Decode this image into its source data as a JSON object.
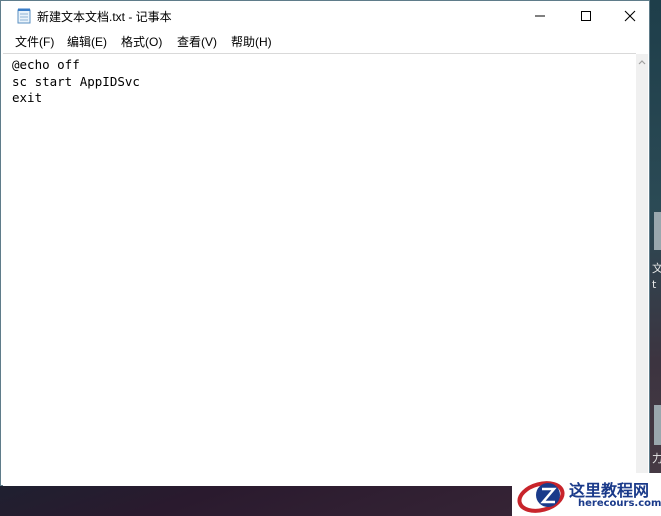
{
  "window": {
    "title": "新建文本文档.txt - 记事本"
  },
  "menu": {
    "items": [
      {
        "label": "文件(F)"
      },
      {
        "label": "编辑(E)"
      },
      {
        "label": "格式(O)"
      },
      {
        "label": "查看(V)"
      },
      {
        "label": "帮助(H)"
      }
    ]
  },
  "editor": {
    "content": "@echo off\nsc start AppIDSvc\nexit"
  },
  "desktop": {
    "snippet_1": "文",
    "snippet_2": "t",
    "snippet_3": "力"
  },
  "watermark": {
    "title": "这里教程网",
    "url": "herecours.com"
  },
  "colors": {
    "window_border": "#5f7c8a",
    "watermark_red": "#c8242b",
    "watermark_blue": "#1a3a8a"
  }
}
